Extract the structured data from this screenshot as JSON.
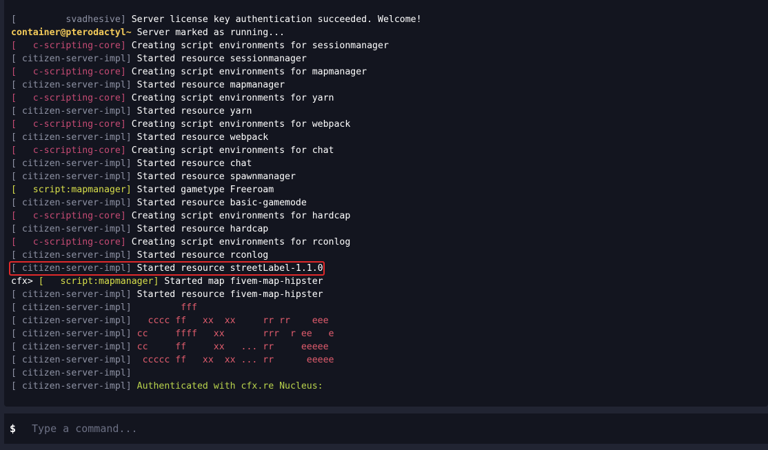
{
  "console": {
    "lines": [
      {
        "kind": "tagged",
        "tag": "         svadhesive",
        "tag_class": "svadhesive",
        "text": "Server license key authentication succeeded. Welcome!",
        "msg_class": "msg"
      },
      {
        "kind": "prompt",
        "prompt": "container@pterodactyl~",
        "text": "Server marked as running...",
        "msg_class": "msg"
      },
      {
        "kind": "tagged",
        "tag": "   c-scripting-core",
        "tag_class": "core",
        "text": "Creating script environments for sessionmanager",
        "msg_class": "msg"
      },
      {
        "kind": "tagged",
        "tag": " citizen-server-impl",
        "tag_class": "impl",
        "text": "Started resource sessionmanager",
        "msg_class": "msg"
      },
      {
        "kind": "tagged",
        "tag": "   c-scripting-core",
        "tag_class": "core",
        "text": "Creating script environments for mapmanager",
        "msg_class": "msg"
      },
      {
        "kind": "tagged",
        "tag": " citizen-server-impl",
        "tag_class": "impl",
        "text": "Started resource mapmanager",
        "msg_class": "msg"
      },
      {
        "kind": "tagged",
        "tag": "   c-scripting-core",
        "tag_class": "core",
        "text": "Creating script environments for yarn",
        "msg_class": "msg"
      },
      {
        "kind": "tagged",
        "tag": " citizen-server-impl",
        "tag_class": "impl",
        "text": "Started resource yarn",
        "msg_class": "msg"
      },
      {
        "kind": "tagged",
        "tag": "   c-scripting-core",
        "tag_class": "core",
        "text": "Creating script environments for webpack",
        "msg_class": "msg"
      },
      {
        "kind": "tagged",
        "tag": " citizen-server-impl",
        "tag_class": "impl",
        "text": "Started resource webpack",
        "msg_class": "msg"
      },
      {
        "kind": "tagged",
        "tag": "   c-scripting-core",
        "tag_class": "core",
        "text": "Creating script environments for chat",
        "msg_class": "msg"
      },
      {
        "kind": "tagged",
        "tag": " citizen-server-impl",
        "tag_class": "impl",
        "text": "Started resource chat",
        "msg_class": "msg"
      },
      {
        "kind": "tagged",
        "tag": " citizen-server-impl",
        "tag_class": "impl",
        "text": "Started resource spawnmanager",
        "msg_class": "msg"
      },
      {
        "kind": "tagged",
        "tag": "   script:mapmanager",
        "tag_class": "script",
        "text": "Started gametype Freeroam",
        "msg_class": "msg"
      },
      {
        "kind": "tagged",
        "tag": " citizen-server-impl",
        "tag_class": "impl",
        "text": "Started resource basic-gamemode",
        "msg_class": "msg"
      },
      {
        "kind": "tagged",
        "tag": "   c-scripting-core",
        "tag_class": "core",
        "text": "Creating script environments for hardcap",
        "msg_class": "msg"
      },
      {
        "kind": "tagged",
        "tag": " citizen-server-impl",
        "tag_class": "impl",
        "text": "Started resource hardcap",
        "msg_class": "msg"
      },
      {
        "kind": "tagged",
        "tag": "   c-scripting-core",
        "tag_class": "core",
        "text": "Creating script environments for rconlog",
        "msg_class": "msg"
      },
      {
        "kind": "tagged",
        "tag": " citizen-server-impl",
        "tag_class": "impl",
        "text": "Started resource rconlog",
        "msg_class": "msg"
      },
      {
        "kind": "tagged",
        "tag": " citizen-server-impl",
        "tag_class": "impl",
        "text": "Started resource streetLabel-1.1.0",
        "msg_class": "msg",
        "highlighted": true
      },
      {
        "kind": "cfx",
        "prompt": "cfx> ",
        "tag": "   script:mapmanager",
        "tag_class": "script",
        "text": "Started map fivem-map-hipster",
        "msg_class": "msg"
      },
      {
        "kind": "tagged",
        "tag": " citizen-server-impl",
        "tag_class": "impl",
        "text": "Started resource fivem-map-hipster",
        "msg_class": "msg"
      },
      {
        "kind": "tagged",
        "tag": " citizen-server-impl",
        "tag_class": "impl",
        "text": "        fff",
        "msg_class": "msg-art"
      },
      {
        "kind": "tagged",
        "tag": " citizen-server-impl",
        "tag_class": "impl",
        "text": "  cccc ff   xx  xx     rr rr    eee",
        "msg_class": "msg-art"
      },
      {
        "kind": "tagged",
        "tag": " citizen-server-impl",
        "tag_class": "impl",
        "text": "cc     ffff   xx       rrr  r ee   e",
        "msg_class": "msg-art"
      },
      {
        "kind": "tagged",
        "tag": " citizen-server-impl",
        "tag_class": "impl",
        "text": "cc     ff     xx   ... rr     eeeee",
        "msg_class": "msg-art"
      },
      {
        "kind": "tagged",
        "tag": " citizen-server-impl",
        "tag_class": "impl",
        "text": " ccccc ff   xx  xx ... rr      eeeee",
        "msg_class": "msg-art"
      },
      {
        "kind": "tagged",
        "tag": " citizen-server-impl",
        "tag_class": "impl",
        "text": "",
        "msg_class": "msg"
      },
      {
        "kind": "tagged",
        "tag": " citizen-server-impl",
        "tag_class": "impl",
        "text": "Authenticated with cfx.re Nucleus:",
        "msg_class": "msg-auth"
      }
    ]
  },
  "input": {
    "prompt_symbol": "$",
    "placeholder": "Type a command..."
  },
  "colors": {
    "background": "#212432",
    "console_bg": "#13151f",
    "tag_impl": "#8e92a4",
    "tag_core": "#c64b74",
    "tag_script": "#d8df4a",
    "prompt_user": "#f4cb5a",
    "art": "#e05c6d",
    "auth": "#b9d34c",
    "highlight_border": "#e0292a"
  }
}
